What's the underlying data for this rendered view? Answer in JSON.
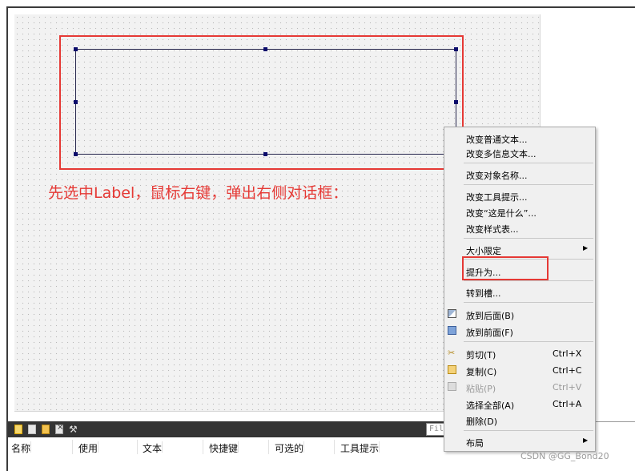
{
  "annotation": "先选中Label，鼠标右键，弹出右侧对话框：",
  "toolbar": {
    "filter_placeholder": "Fil"
  },
  "table": {
    "columns": [
      "名称",
      "使用",
      "文本",
      "快捷键",
      "可选的",
      "工具提示"
    ]
  },
  "context_menu": {
    "items": [
      {
        "label": "改变普通文本...",
        "icon": ""
      },
      {
        "label": "改变多信息文本...",
        "icon": ""
      },
      {
        "label": "改变对象名称...",
        "icon": ""
      },
      {
        "label": "改变工具提示...",
        "icon": ""
      },
      {
        "label": "改变“这是什么”...",
        "icon": ""
      },
      {
        "label": "改变样式表...",
        "icon": ""
      },
      {
        "label": "大小限定",
        "submenu": true
      },
      {
        "label": "提升为...",
        "highlighted": true
      },
      {
        "label": "转到槽...",
        "icon": ""
      },
      {
        "label": "放到后面(B)",
        "icon": "send-back-icon"
      },
      {
        "label": "放到前面(F)",
        "icon": "bring-front-icon"
      },
      {
        "label": "剪切(T)",
        "shortcut": "Ctrl+X",
        "icon": "cut-icon"
      },
      {
        "label": "复制(C)",
        "shortcut": "Ctrl+C",
        "icon": "copy-icon"
      },
      {
        "label": "粘贴(P)",
        "shortcut": "Ctrl+V",
        "icon": "paste-icon",
        "disabled": true
      },
      {
        "label": "选择全部(A)",
        "shortcut": "Ctrl+A"
      },
      {
        "label": "删除(D)"
      },
      {
        "label": "布局",
        "submenu": true
      }
    ]
  },
  "watermark": "CSDN @GG_Bond20",
  "colors": {
    "highlight": "#e53935",
    "canvas": "#f2f2f2",
    "menu": "#f0f0f0",
    "toolbar": "#343434"
  }
}
